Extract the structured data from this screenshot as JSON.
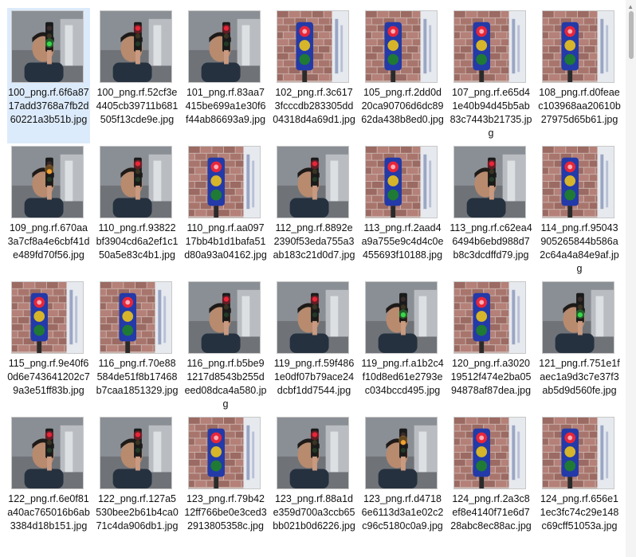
{
  "colors": {
    "selection": "#dcebfb",
    "text": "#111111",
    "red_light": "#e8263a",
    "green_light": "#3ad64a",
    "yellow_light": "#d6b52a",
    "blue_housing": "#233aa8"
  },
  "scene_kinds": {
    "man": "person holding small traffic light indoors",
    "wall": "toy traffic light against brick wall"
  },
  "files": [
    {
      "name": "100_png.rf.6f6a8717add3768a7fb2d60221a3b51b.jpg",
      "scene": "man",
      "light": "green",
      "selected": true
    },
    {
      "name": "100_png.rf.52cf3e4405cb39711b681505f13cde9e.jpg",
      "scene": "man",
      "light": "red",
      "selected": false
    },
    {
      "name": "101_png.rf.83aa7415be699a1e30f6f44ab86693a9.jpg",
      "scene": "man",
      "light": "red",
      "selected": false
    },
    {
      "name": "102_png.rf.3c6173fcccdb283305dd04318d4a69d1.jpg",
      "scene": "wall",
      "light": "red",
      "selected": false
    },
    {
      "name": "105_png.rf.2dd0d20ca90706d6dc8962da438b8ed0.jpg",
      "scene": "wall",
      "light": "red",
      "selected": false
    },
    {
      "name": "107_png.rf.e65d41e40b94d45b5ab83c7443b21735.jpg",
      "scene": "wall",
      "light": "red",
      "selected": false
    },
    {
      "name": "108_png.rf.d0feaec103968aa20610b27975d65b61.jpg",
      "scene": "wall",
      "light": "red",
      "selected": false
    },
    {
      "name": "109_png.rf.670aa3a7cf8a4e6cbf41de489fd70f56.jpg",
      "scene": "man",
      "light": "amber",
      "selected": false
    },
    {
      "name": "110_png.rf.93822bf3904cd6a2ef1c150a5e83c4b1.jpg",
      "scene": "man",
      "light": "red",
      "selected": false
    },
    {
      "name": "110_png.rf.aa09717bb4b1d1bafa51d80a93a04162.jpg",
      "scene": "wall",
      "light": "red",
      "selected": false
    },
    {
      "name": "112_png.rf.8892e2390f53eda755a3ab183c21d0d7.jpg",
      "scene": "man",
      "light": "red",
      "selected": false
    },
    {
      "name": "113_png.rf.2aad4a9a755e9c4d4c0e455693f10188.jpg",
      "scene": "wall",
      "light": "red",
      "selected": false
    },
    {
      "name": "113_png.rf.c62ea46494b6ebd988d7b8c3dcdffd79.jpg",
      "scene": "man",
      "light": "red",
      "selected": false
    },
    {
      "name": "114_png.rf.95043905265844b586a2c64a4a84e9af.jpg",
      "scene": "wall",
      "light": "red",
      "selected": false
    },
    {
      "name": "115_png.rf.9e40f60d6e743641202c79a3e51ff83b.jpg",
      "scene": "wall",
      "light": "red",
      "selected": false
    },
    {
      "name": "116_png.rf.70e88584de51f8b17468b7caa1851329.jpg",
      "scene": "wall",
      "light": "red",
      "selected": false
    },
    {
      "name": "116_png.rf.b5be91217d8543b255deed08dca4a580.jpg",
      "scene": "man",
      "light": "red",
      "selected": false
    },
    {
      "name": "119_png.rf.59f4861e0df07b79ace24dcbf1dd7544.jpg",
      "scene": "man",
      "light": "red",
      "selected": false
    },
    {
      "name": "119_png.rf.a1b2c4f10d8ed61e2793ec034bccd495.jpg",
      "scene": "man",
      "light": "green",
      "selected": false
    },
    {
      "name": "120_png.rf.a302019512f474e2ba0594878af87dea.jpg",
      "scene": "wall",
      "light": "red",
      "selected": false
    },
    {
      "name": "121_png.rf.751e1faec1a9d3c7e37f3ab5d9d560fe.jpg",
      "scene": "man",
      "light": "green",
      "selected": false
    },
    {
      "name": "122_png.rf.6e0f81a40ac765016b6ab3384d18b151.jpg",
      "scene": "man",
      "light": "red",
      "selected": false
    },
    {
      "name": "122_png.rf.127a5530bee2b61b4ca071c4da906db1.jpg",
      "scene": "man",
      "light": "red",
      "selected": false
    },
    {
      "name": "123_png.rf.79b4212ff766be0e3ced32913805358c.jpg",
      "scene": "wall",
      "light": "red",
      "selected": false
    },
    {
      "name": "123_png.rf.88a1de359d700a3ccb65bb021b0d6226.jpg",
      "scene": "man",
      "light": "red",
      "selected": false
    },
    {
      "name": "123_png.rf.d47186e6113d3a1e02c2c96c5180c0a9.jpg",
      "scene": "man",
      "light": "amber",
      "selected": false
    },
    {
      "name": "124_png.rf.2a3c8ef8e4140f71e6d728abc8ec88ac.jpg",
      "scene": "wall",
      "light": "red",
      "selected": false
    },
    {
      "name": "124_png.rf.656e11ec3fc74c29e148c69cff51053a.jpg",
      "scene": "wall",
      "light": "red",
      "selected": false
    }
  ]
}
